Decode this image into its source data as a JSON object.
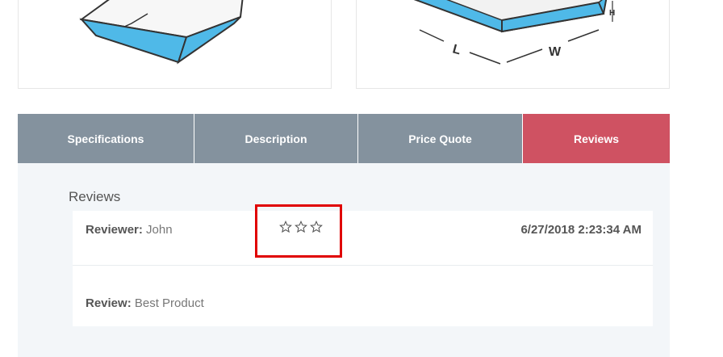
{
  "product_images": [
    {
      "name": "box-tray-image"
    },
    {
      "name": "box-dimensions-image",
      "labels": {
        "length": "L",
        "width": "W",
        "height": "H"
      }
    }
  ],
  "tabs": [
    {
      "label": "Specifications",
      "active": false
    },
    {
      "label": "Description",
      "active": false
    },
    {
      "label": "Price Quote",
      "active": false
    },
    {
      "label": "Reviews",
      "active": true
    }
  ],
  "reviews": {
    "title": "Reviews",
    "items": [
      {
        "reviewer_label": "Reviewer:",
        "reviewer_name": "John",
        "rating": {
          "filled": 0,
          "max": 3
        },
        "date": "6/27/2018 2:23:34 AM",
        "review_label": "Review:",
        "review_text": "Best Product"
      }
    ]
  },
  "colors": {
    "tab_bg": "#84929e",
    "tab_active_bg": "#cf5262",
    "panel_bg": "#f3f6f9",
    "box_blue": "#4fb9e8",
    "highlight": "#e00000"
  }
}
